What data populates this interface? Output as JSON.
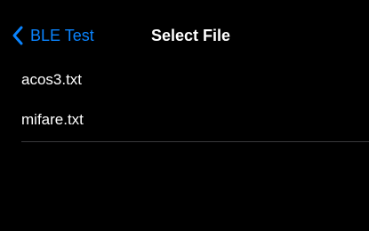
{
  "colors": {
    "background": "#000000",
    "accent": "#0a84ff",
    "text": "#ffffff",
    "separator": "#3a3a3c"
  },
  "navbar": {
    "back_icon": "chevron-left-icon",
    "back_label": "BLE Test",
    "title": "Select File"
  },
  "files": [
    {
      "name": "acos3.txt"
    },
    {
      "name": "mifare.txt"
    }
  ]
}
